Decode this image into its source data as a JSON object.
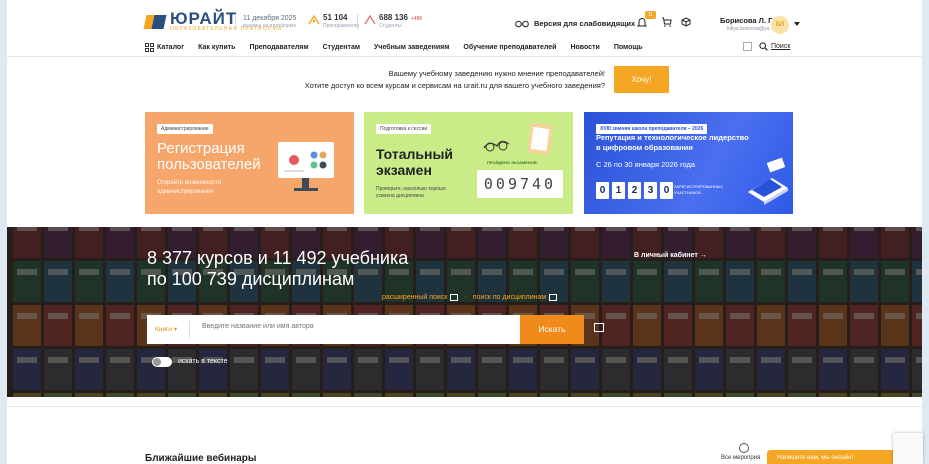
{
  "header": {
    "logo_word": "ЮРАЙТ",
    "logo_sub": "ОБРАЗОВАТЕЛЬНАЯ ПЛАТФОРМА",
    "date": "11 декабря 2025",
    "date_sub": "вузовец на платформе",
    "stats": [
      {
        "value": "51 104",
        "plus": "",
        "label": "Преподаватели",
        "icon": "teacher-icon"
      },
      {
        "value": "688 136",
        "plus": "+486",
        "label": "Студенты",
        "icon": "student-icon"
      }
    ],
    "vision_label": "Версия для слабовидящих",
    "notification_count": "11",
    "user_name": "Борисова Л. Г.",
    "user_email": "lidiya.borisova@ya...",
    "avatar_initials": "БЛ"
  },
  "nav": {
    "items": [
      "Каталог",
      "Как купить",
      "Преподавателям",
      "Студентам",
      "Учебным заведениям",
      "Обучение преподавателей",
      "Новости",
      "Помощь"
    ],
    "search_label": "Поиск"
  },
  "promo": {
    "line1": "Вашему учебному заведению нужно мнение преподавателей!",
    "line2": "Хотите доступ ко всем курсам и сервисам на urait.ru для вашего учебного заведения?",
    "button": "Хочу!"
  },
  "cards": [
    {
      "tag": "Администрирование",
      "title": "Регистрация пользователей",
      "text": "Откройте возможности администрирования"
    },
    {
      "tag": "Подготовка к сессии",
      "title": "Тотальный экзамен",
      "text": "Проверьте, насколько хорошо усвоена дисциплина",
      "counter_label": "ПРОЙДЕНО ЭКЗАМЕНОВ",
      "counter": "009740"
    },
    {
      "tag": "XVIII зимняя школа преподавателя – 2026",
      "title": "Репутация и технологическое лидерство в цифровом образовании",
      "dates": "С 26 по 30 января 2026 года",
      "digits": [
        "0",
        "1",
        "2",
        "3",
        "0"
      ],
      "digits_label": "ЗАРЕГИСТРИРОВАННЫХ УЧАСТНИКОВ"
    }
  ],
  "hero": {
    "title_line1": "8 377 курсов и 11 492 учебника",
    "title_line2": "по 100 739 дисциплинам",
    "cabinet": "В личный кабинет →",
    "adv_search": "расширенный поиск",
    "disc_search": "поиск по дисциплинам",
    "dot": "·",
    "select": "Книги ▾",
    "placeholder": "Введите название или имя автора",
    "search_button": "Искать",
    "toggle_label": "искать в тексте"
  },
  "bottom": {
    "webinars": "Ближайшие вебинары",
    "all_events": "Все мероприя",
    "chat": "Напишите нам, мы онлайн!"
  },
  "colors": {
    "accent": "#f5a623",
    "brand": "#2a4f7d",
    "search_button": "#f08a1a"
  }
}
